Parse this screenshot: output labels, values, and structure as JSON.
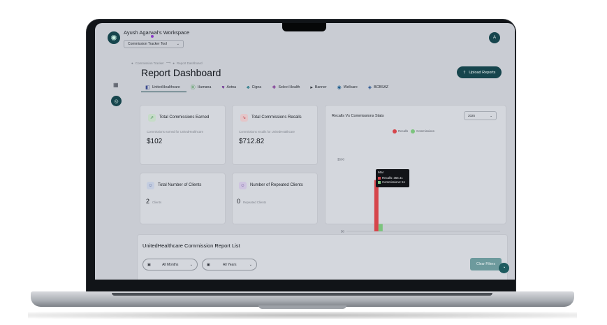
{
  "workspace": {
    "title": "Ayush Agarwal's Workspace",
    "tool_select": "Commission Tracker Tool",
    "avatar_initial": "A"
  },
  "breadcrumb": [
    "Commission Tracker",
    "Report Dashboard"
  ],
  "page": {
    "title": "Report Dashboard",
    "upload_label": "Upload Reports"
  },
  "tabs": [
    {
      "label": "UnitedHealthcare",
      "active": true,
      "color": "#3b4a8f"
    },
    {
      "label": "Humana",
      "active": false,
      "color": "#2f8f3a"
    },
    {
      "label": "Aetna",
      "active": false,
      "color": "#6b2c8f"
    },
    {
      "label": "Cigna",
      "active": false,
      "color": "#2d7d8c"
    },
    {
      "label": "Select Health",
      "active": false,
      "color": "#7a2c8f"
    },
    {
      "label": "Banner",
      "active": false,
      "color": "#2a2f36"
    },
    {
      "label": "Wellcare",
      "active": false,
      "color": "#1f5f8f"
    },
    {
      "label": "BCBSAZ",
      "active": false,
      "color": "#1f4f8f"
    }
  ],
  "cards": {
    "earned": {
      "title": "Total Commissions Earned",
      "subtitle": "Commissions earned for UnitedHealthcare",
      "value": "$102"
    },
    "recalls": {
      "title": "Total Commissions Recalls",
      "subtitle": "Commissions recalls for UnitedHealthcare",
      "value": "$712.82"
    },
    "clients": {
      "title": "Total Number of Clients",
      "count": "2",
      "unit": "Clients"
    },
    "repeated": {
      "title": "Number of Repeated Clients",
      "count": "0",
      "unit": "Repeated Clients"
    }
  },
  "chart": {
    "title": "Recalls Vs Commissions Stats",
    "year": "2025",
    "tooltip": {
      "month": "Mar",
      "recalls": "Recalls: 356.41",
      "commissions": "Commissions: 51"
    }
  },
  "chart_data": {
    "type": "bar",
    "categories": [
      "Jan",
      "Feb",
      "Mar",
      "Apr",
      "May",
      "Jun",
      "Jul",
      "Aug",
      "Sep",
      "Oct",
      "Nov",
      "Dec"
    ],
    "series": [
      {
        "name": "Recalls",
        "color": "#d6454b",
        "values": [
          0,
          0,
          356.41,
          0,
          0,
          0,
          0,
          0,
          0,
          0,
          0,
          0
        ]
      },
      {
        "name": "Commissions",
        "color": "#7cc47e",
        "values": [
          0,
          0,
          51,
          0,
          0,
          0,
          0,
          0,
          0,
          0,
          0,
          0
        ]
      }
    ],
    "y_tick_labels": [
      "$500",
      "$0"
    ],
    "ylim": [
      0,
      500
    ],
    "legend": "top-center",
    "grid": false
  },
  "report": {
    "title": "UnitedHealthcare Commission Report List",
    "month_filter": "All Months",
    "year_filter": "All Years",
    "clear_label": "Clear Filters"
  },
  "icons": {
    "logo": "flower-logo-icon",
    "grid": "grid-icon",
    "bar": "report-icon"
  }
}
